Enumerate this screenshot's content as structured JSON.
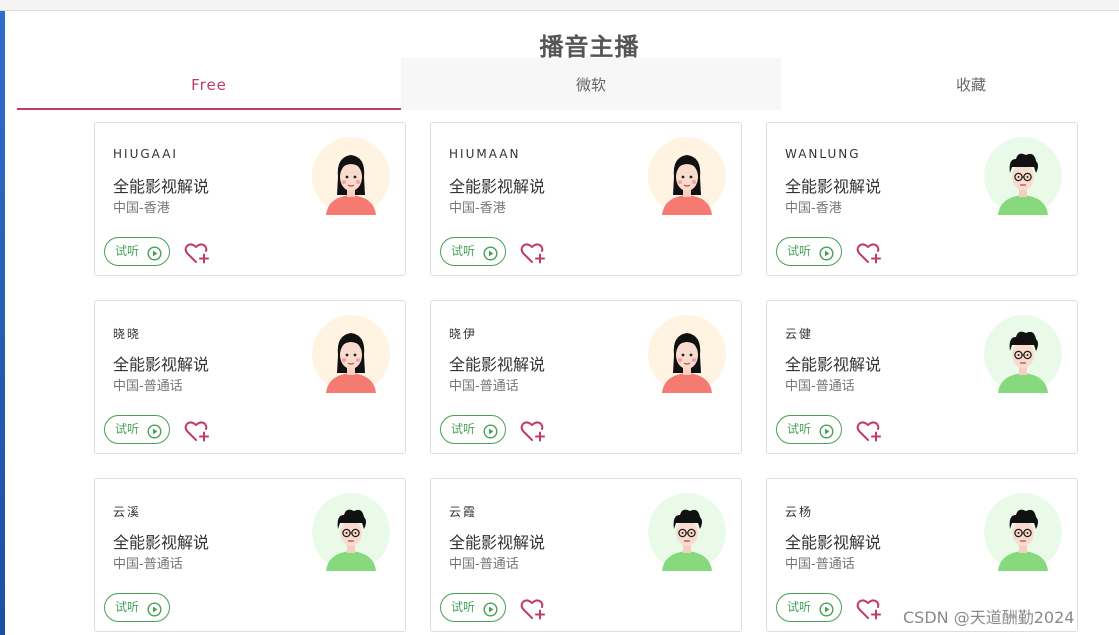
{
  "page": {
    "title": "播音主播"
  },
  "tabs": [
    {
      "label": "Free",
      "active": true
    },
    {
      "label": "微软",
      "active": false
    },
    {
      "label": "收藏",
      "active": false
    }
  ],
  "colors": {
    "accent": "#c23a6a",
    "listen_green": "#4aa156",
    "female_bg": "#fff3e2",
    "female_shirt": "#f47a72",
    "male_bg": "#e9fbe8",
    "male_shirt": "#86d97d"
  },
  "cards": [
    {
      "name": "HIUGAAI",
      "desc": "全能影视解说",
      "region": "中国-香港",
      "listen_label": "试听",
      "avatar": "female-avatar-icon",
      "show_fav": true
    },
    {
      "name": "HIUMAAN",
      "desc": "全能影视解说",
      "region": "中国-香港",
      "listen_label": "试听",
      "avatar": "female-avatar-icon",
      "show_fav": true
    },
    {
      "name": "WANLUNG",
      "desc": "全能影视解说",
      "region": "中国-香港",
      "listen_label": "试听",
      "avatar": "male-avatar-icon",
      "show_fav": true
    },
    {
      "name": "晓晓",
      "desc": "全能影视解说",
      "region": "中国-普通话",
      "listen_label": "试听",
      "avatar": "female-avatar-icon",
      "show_fav": true
    },
    {
      "name": "晓伊",
      "desc": "全能影视解说",
      "region": "中国-普通话",
      "listen_label": "试听",
      "avatar": "female-avatar-icon",
      "show_fav": true
    },
    {
      "name": "云健",
      "desc": "全能影视解说",
      "region": "中国-普通话",
      "listen_label": "试听",
      "avatar": "male-avatar-icon",
      "show_fav": true
    },
    {
      "name": "云溪",
      "desc": "全能影视解说",
      "region": "中国-普通话",
      "listen_label": "试听",
      "avatar": "male-avatar-icon",
      "show_fav": false
    },
    {
      "name": "云霞",
      "desc": "全能影视解说",
      "region": "中国-普通话",
      "listen_label": "试听",
      "avatar": "male-avatar-icon",
      "show_fav": true
    },
    {
      "name": "云杨",
      "desc": "全能影视解说",
      "region": "中国-普通话",
      "listen_label": "试听",
      "avatar": "male-avatar-icon",
      "show_fav": true
    }
  ],
  "watermark": "CSDN @天道酬勤2024"
}
